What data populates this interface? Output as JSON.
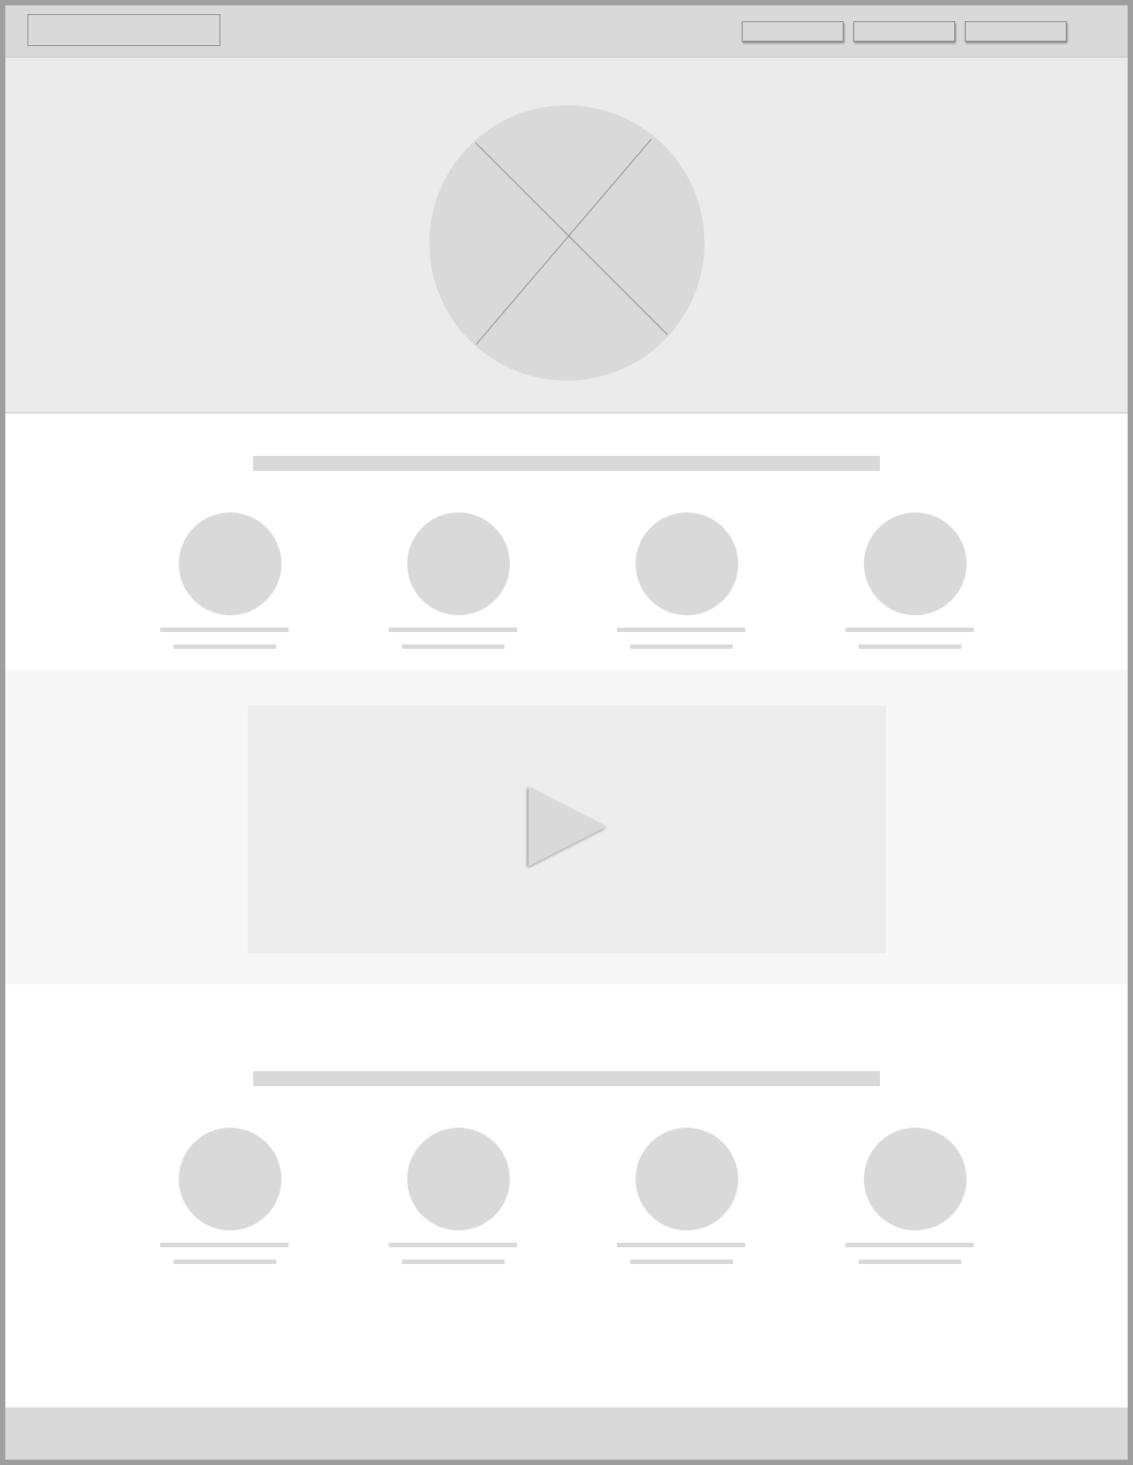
{
  "header": {
    "logo": "",
    "nav": [
      "",
      "",
      ""
    ]
  },
  "hero": {
    "image": "image-placeholder-icon"
  },
  "sections": [
    {
      "title": "",
      "people": [
        {
          "name": "",
          "role": ""
        },
        {
          "name": "",
          "role": ""
        },
        {
          "name": "",
          "role": ""
        },
        {
          "name": "",
          "role": ""
        }
      ]
    },
    {
      "title": "",
      "people": [
        {
          "name": "",
          "role": ""
        },
        {
          "name": "",
          "role": ""
        },
        {
          "name": "",
          "role": ""
        },
        {
          "name": "",
          "role": ""
        }
      ]
    }
  ],
  "video": {
    "icon": "play-icon"
  },
  "footer": {
    "text": ""
  },
  "colors": {
    "frame": "#9e9e9e",
    "header": "#d9d9d9",
    "hero": "#ebebeb",
    "placeholder": "#d9d9d9",
    "video_band": "#f7f7f7",
    "video": "#ededed"
  }
}
